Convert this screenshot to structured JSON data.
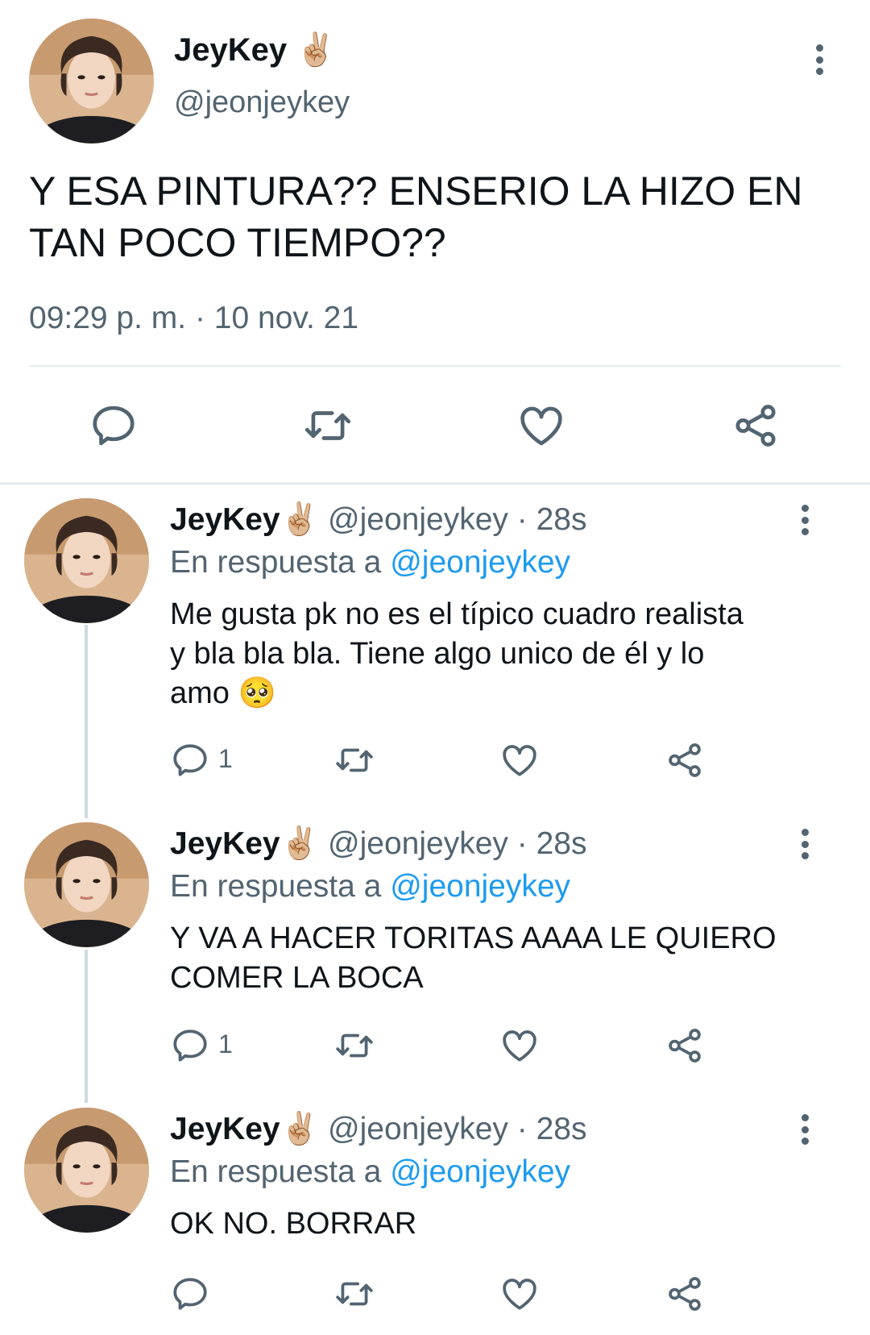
{
  "main_tweet": {
    "display_name": "JeyKey",
    "name_emoji": "✌🏼",
    "handle": "@jeonjeykey",
    "text_line1": "Y ESA PINTURA?? ENSERIO LA HIZO EN",
    "text_line2": "TAN POCO TIEMPO??",
    "timestamp": "09:29 p. m. · 10 nov. 21",
    "icons": [
      "reply-icon",
      "retweet-icon",
      "like-icon",
      "share-icon"
    ]
  },
  "replies": [
    {
      "display_name": "JeyKey",
      "name_emoji": "✌🏼",
      "handle": "@jeonjeykey",
      "time": "· 28s",
      "reply_prefix": "En respuesta a",
      "reply_to": "@jeonjeykey",
      "lines": [
        "Me gusta pk no es el típico cuadro realista",
        "y bla bla bla. Tiene algo unico de él y lo",
        "amo 🥺"
      ],
      "reply_count": "1"
    },
    {
      "display_name": "JeyKey",
      "name_emoji": "✌🏼",
      "handle": "@jeonjeykey",
      "time": "· 28s",
      "reply_prefix": "En respuesta a",
      "reply_to": "@jeonjeykey",
      "lines": [
        "Y VA A HACER TORITAS AAAA LE QUIERO",
        "COMER LA BOCA"
      ],
      "reply_count": "1"
    },
    {
      "display_name": "JeyKey",
      "name_emoji": "✌🏼",
      "handle": "@jeonjeykey",
      "time": "· 28s",
      "reply_prefix": "En respuesta a",
      "reply_to": "@jeonjeykey",
      "lines": [
        "OK NO. BORRAR"
      ],
      "reply_count": ""
    }
  ],
  "colors": {
    "accent": "#1d9bf0",
    "secondary_text": "#536471",
    "divider": "#e6ecf0"
  }
}
